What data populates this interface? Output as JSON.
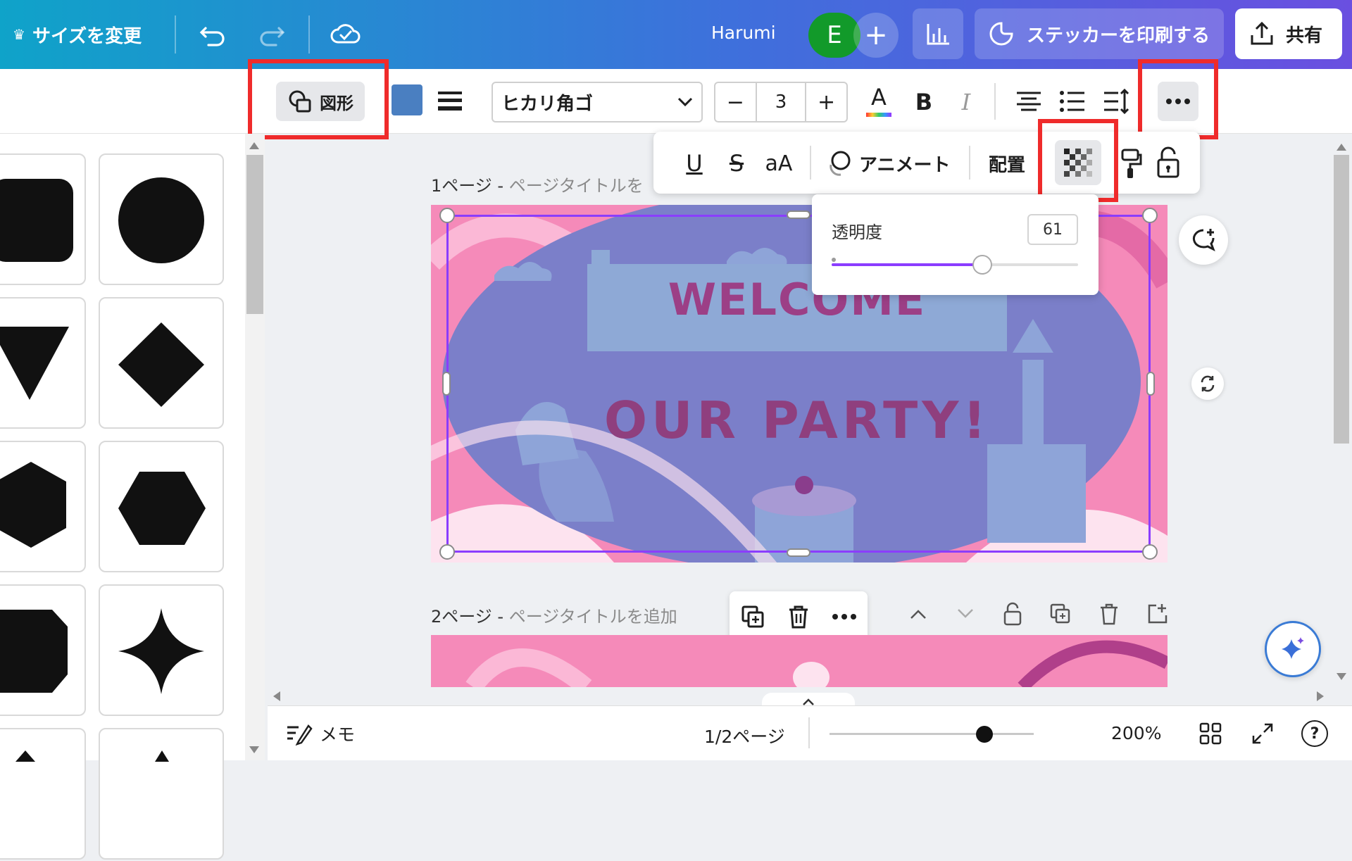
{
  "topbar": {
    "resize_label": "サイズを変更",
    "user_name": "Harumi",
    "avatar_initial": "E",
    "sticker_label": "ステッカーを印刷する",
    "share_label": "共有"
  },
  "toolbar": {
    "shape_label": "図形",
    "shape_color": "#4a7fc1",
    "font_name": "ヒカリ角ゴ",
    "font_size": "3",
    "minus_label": "−",
    "plus_label": "+",
    "text_color_label": "A",
    "bold_label": "B",
    "italic_label": "I"
  },
  "subbar": {
    "underline_label": "U",
    "strike_label": "S",
    "case_label": "aA",
    "animate_label": "アニメート",
    "position_label": "配置"
  },
  "transparency": {
    "label": "透明度",
    "value": "61",
    "slider_fraction": 0.61
  },
  "pages": {
    "page1_prefix": "1ページ - ",
    "page1_placeholder": "ページタイトルを",
    "page2_prefix": "2ページ - ",
    "page2_placeholder": "ページタイトルを追加"
  },
  "design": {
    "welcome_text": "WELCOME",
    "party_text": "OUR PARTY!"
  },
  "bottom": {
    "memo_label": "メモ",
    "page_counter": "1/2ページ",
    "zoom_label": "200%",
    "zoom_fraction": 0.76
  },
  "colors": {
    "highlight": "#ef2b2b",
    "selection": "#8b3dff",
    "design_pink": "#f58ab9",
    "overlay_purple": "#7b7fc9"
  }
}
